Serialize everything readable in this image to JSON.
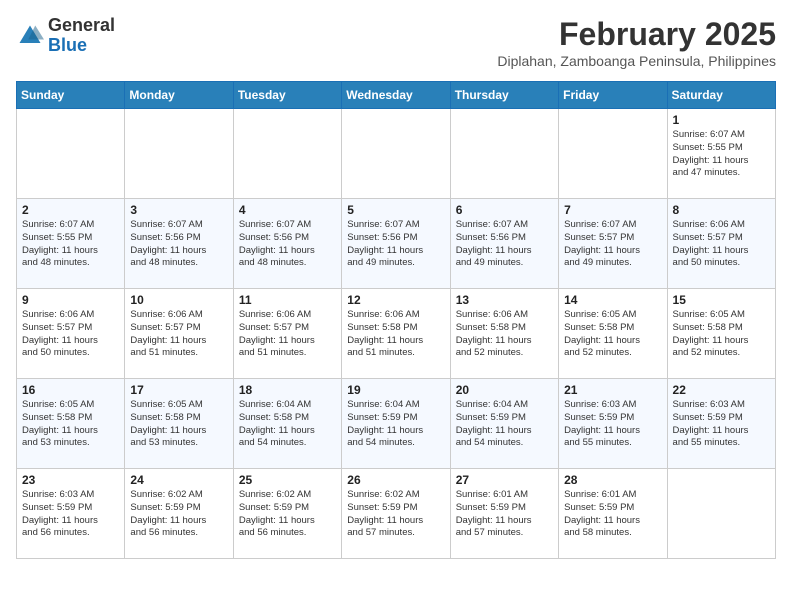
{
  "header": {
    "logo_general": "General",
    "logo_blue": "Blue",
    "month_year": "February 2025",
    "location": "Diplahan, Zamboanga Peninsula, Philippines"
  },
  "weekdays": [
    "Sunday",
    "Monday",
    "Tuesday",
    "Wednesday",
    "Thursday",
    "Friday",
    "Saturday"
  ],
  "weeks": [
    [
      {
        "day": "",
        "info": ""
      },
      {
        "day": "",
        "info": ""
      },
      {
        "day": "",
        "info": ""
      },
      {
        "day": "",
        "info": ""
      },
      {
        "day": "",
        "info": ""
      },
      {
        "day": "",
        "info": ""
      },
      {
        "day": "1",
        "info": "Sunrise: 6:07 AM\nSunset: 5:55 PM\nDaylight: 11 hours\nand 47 minutes."
      }
    ],
    [
      {
        "day": "2",
        "info": "Sunrise: 6:07 AM\nSunset: 5:55 PM\nDaylight: 11 hours\nand 48 minutes."
      },
      {
        "day": "3",
        "info": "Sunrise: 6:07 AM\nSunset: 5:56 PM\nDaylight: 11 hours\nand 48 minutes."
      },
      {
        "day": "4",
        "info": "Sunrise: 6:07 AM\nSunset: 5:56 PM\nDaylight: 11 hours\nand 48 minutes."
      },
      {
        "day": "5",
        "info": "Sunrise: 6:07 AM\nSunset: 5:56 PM\nDaylight: 11 hours\nand 49 minutes."
      },
      {
        "day": "6",
        "info": "Sunrise: 6:07 AM\nSunset: 5:56 PM\nDaylight: 11 hours\nand 49 minutes."
      },
      {
        "day": "7",
        "info": "Sunrise: 6:07 AM\nSunset: 5:57 PM\nDaylight: 11 hours\nand 49 minutes."
      },
      {
        "day": "8",
        "info": "Sunrise: 6:06 AM\nSunset: 5:57 PM\nDaylight: 11 hours\nand 50 minutes."
      }
    ],
    [
      {
        "day": "9",
        "info": "Sunrise: 6:06 AM\nSunset: 5:57 PM\nDaylight: 11 hours\nand 50 minutes."
      },
      {
        "day": "10",
        "info": "Sunrise: 6:06 AM\nSunset: 5:57 PM\nDaylight: 11 hours\nand 51 minutes."
      },
      {
        "day": "11",
        "info": "Sunrise: 6:06 AM\nSunset: 5:57 PM\nDaylight: 11 hours\nand 51 minutes."
      },
      {
        "day": "12",
        "info": "Sunrise: 6:06 AM\nSunset: 5:58 PM\nDaylight: 11 hours\nand 51 minutes."
      },
      {
        "day": "13",
        "info": "Sunrise: 6:06 AM\nSunset: 5:58 PM\nDaylight: 11 hours\nand 52 minutes."
      },
      {
        "day": "14",
        "info": "Sunrise: 6:05 AM\nSunset: 5:58 PM\nDaylight: 11 hours\nand 52 minutes."
      },
      {
        "day": "15",
        "info": "Sunrise: 6:05 AM\nSunset: 5:58 PM\nDaylight: 11 hours\nand 52 minutes."
      }
    ],
    [
      {
        "day": "16",
        "info": "Sunrise: 6:05 AM\nSunset: 5:58 PM\nDaylight: 11 hours\nand 53 minutes."
      },
      {
        "day": "17",
        "info": "Sunrise: 6:05 AM\nSunset: 5:58 PM\nDaylight: 11 hours\nand 53 minutes."
      },
      {
        "day": "18",
        "info": "Sunrise: 6:04 AM\nSunset: 5:58 PM\nDaylight: 11 hours\nand 54 minutes."
      },
      {
        "day": "19",
        "info": "Sunrise: 6:04 AM\nSunset: 5:59 PM\nDaylight: 11 hours\nand 54 minutes."
      },
      {
        "day": "20",
        "info": "Sunrise: 6:04 AM\nSunset: 5:59 PM\nDaylight: 11 hours\nand 54 minutes."
      },
      {
        "day": "21",
        "info": "Sunrise: 6:03 AM\nSunset: 5:59 PM\nDaylight: 11 hours\nand 55 minutes."
      },
      {
        "day": "22",
        "info": "Sunrise: 6:03 AM\nSunset: 5:59 PM\nDaylight: 11 hours\nand 55 minutes."
      }
    ],
    [
      {
        "day": "23",
        "info": "Sunrise: 6:03 AM\nSunset: 5:59 PM\nDaylight: 11 hours\nand 56 minutes."
      },
      {
        "day": "24",
        "info": "Sunrise: 6:02 AM\nSunset: 5:59 PM\nDaylight: 11 hours\nand 56 minutes."
      },
      {
        "day": "25",
        "info": "Sunrise: 6:02 AM\nSunset: 5:59 PM\nDaylight: 11 hours\nand 56 minutes."
      },
      {
        "day": "26",
        "info": "Sunrise: 6:02 AM\nSunset: 5:59 PM\nDaylight: 11 hours\nand 57 minutes."
      },
      {
        "day": "27",
        "info": "Sunrise: 6:01 AM\nSunset: 5:59 PM\nDaylight: 11 hours\nand 57 minutes."
      },
      {
        "day": "28",
        "info": "Sunrise: 6:01 AM\nSunset: 5:59 PM\nDaylight: 11 hours\nand 58 minutes."
      },
      {
        "day": "",
        "info": ""
      }
    ]
  ]
}
